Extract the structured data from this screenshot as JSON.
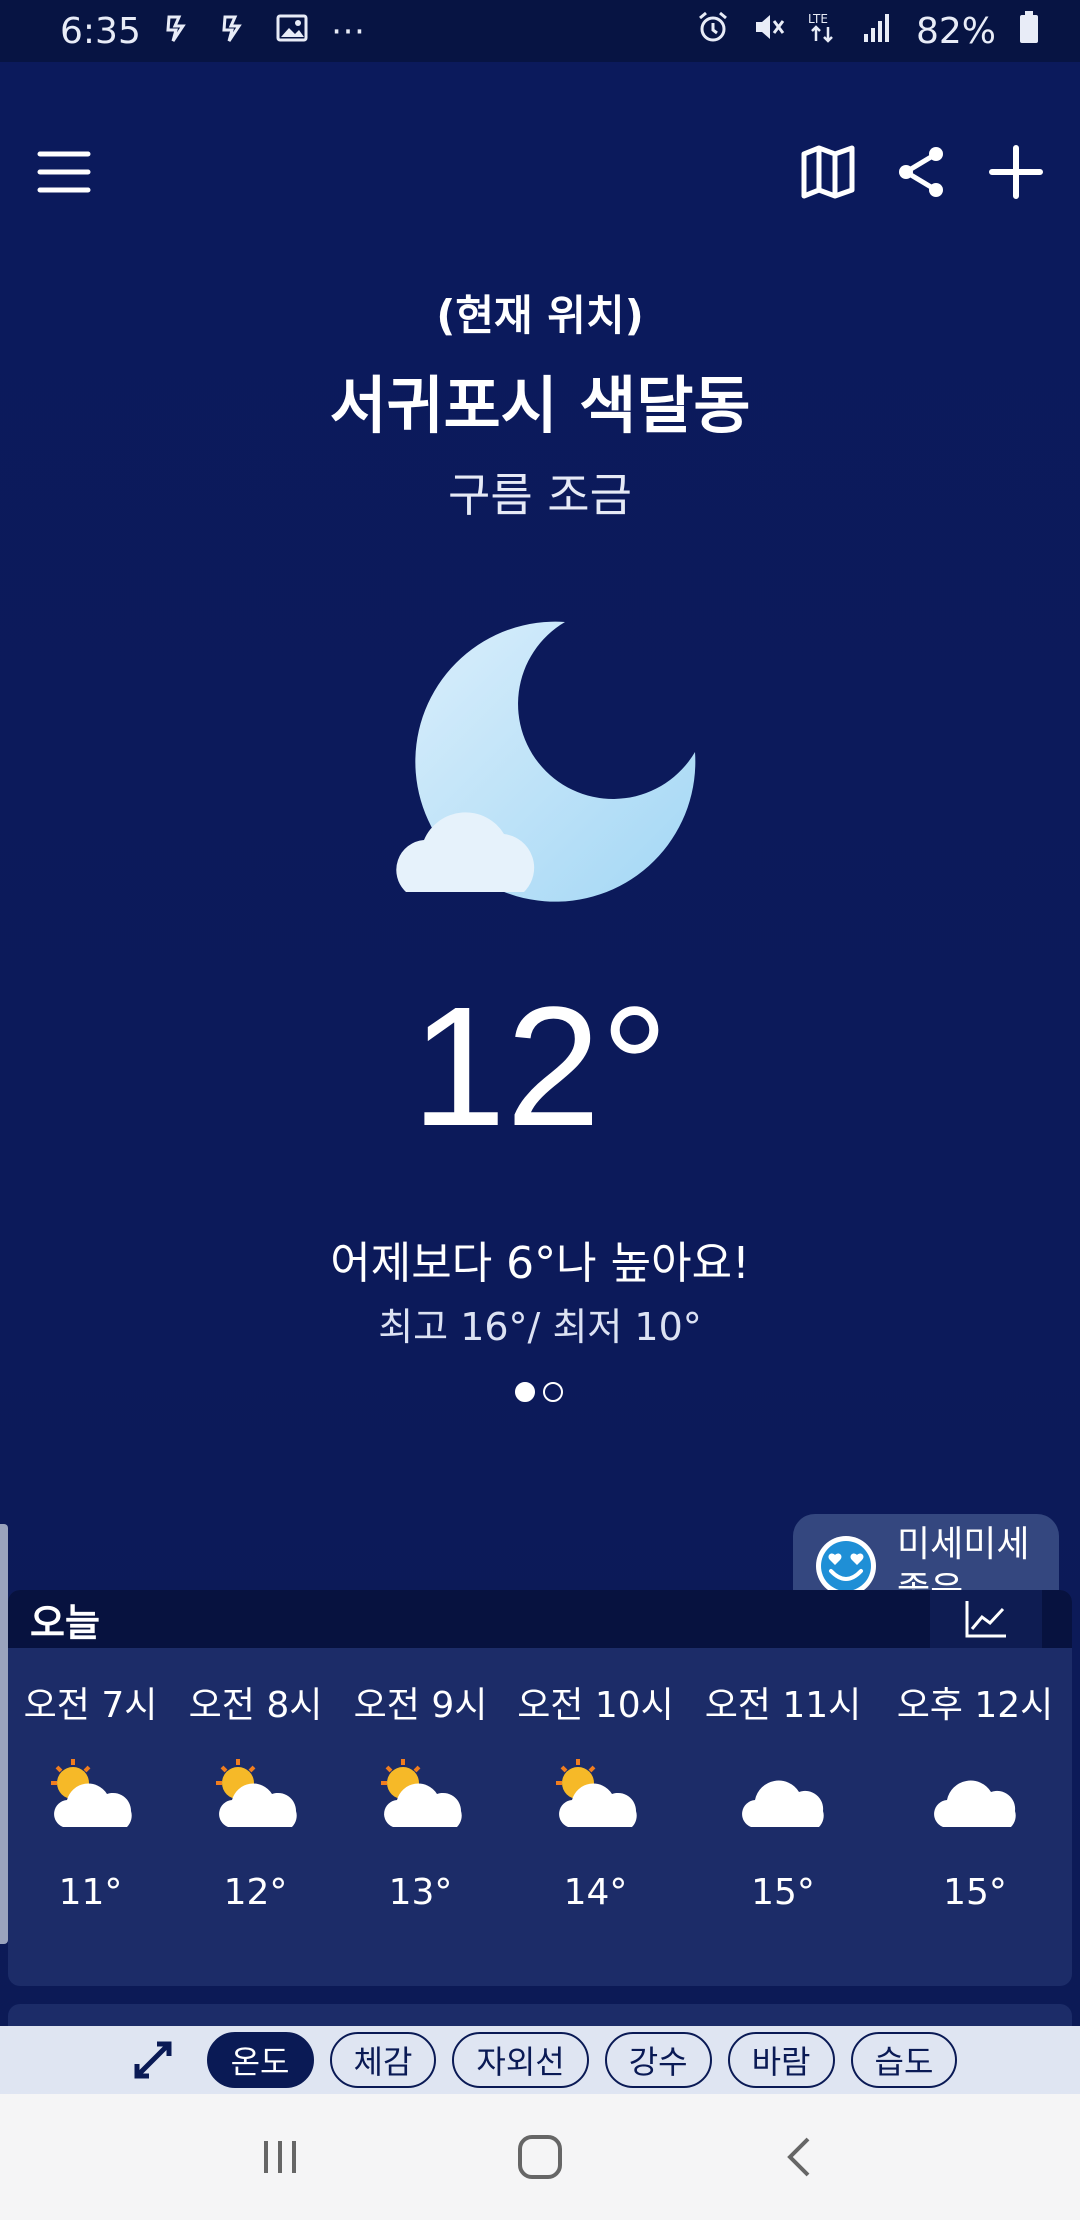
{
  "status_bar": {
    "time": "6:35",
    "left_icons": [
      "flash-icon",
      "flash-icon",
      "image-icon",
      "more-dots-icon"
    ],
    "battery": "82%",
    "right_icons": [
      "alarm-icon",
      "mute-icon",
      "lte-icon",
      "signal-icon",
      "battery-icon"
    ]
  },
  "header": {
    "menu_icon": "hamburger-icon",
    "actions": [
      "map-icon",
      "share-icon",
      "add-icon"
    ]
  },
  "current": {
    "location_caption": "(현재 위치)",
    "location_name": "서귀포시 색달동",
    "condition": "구름 조금",
    "icon": "moon-cloud-icon",
    "temperature": "12°",
    "comparison": "어제보다 6°나 높아요!",
    "high_low": "최고 16°/ 최저 10°",
    "page_count": 2,
    "active_page": 1
  },
  "fine_dust": {
    "icon": "smiley-heart-eyes-icon",
    "label": "미세미세",
    "status": "좋음"
  },
  "today": {
    "title": "오늘",
    "chart_icon": "line-chart-icon",
    "hours": [
      {
        "time": "오전 7시",
        "icon": "sun-cloud-icon",
        "temp": "11°"
      },
      {
        "time": "오전 8시",
        "icon": "sun-cloud-icon",
        "temp": "12°"
      },
      {
        "time": "오전 9시",
        "icon": "sun-cloud-icon",
        "temp": "13°"
      },
      {
        "time": "오전 10시",
        "icon": "sun-cloud-icon",
        "temp": "14°"
      },
      {
        "time": "오전 11시",
        "icon": "cloud-icon",
        "temp": "15°"
      },
      {
        "time": "오후 12시",
        "icon": "cloud-icon",
        "temp": "15°"
      }
    ]
  },
  "filters": {
    "expand_icon": "expand-icon",
    "chips": [
      "온도",
      "체감",
      "자외선",
      "강수",
      "바람",
      "습도"
    ],
    "selected": "온도"
  },
  "nav": [
    "recents-icon",
    "home-icon",
    "back-icon"
  ],
  "colors": {
    "background": "#0b1a5c",
    "status_bar": "#071443",
    "panel": "#1c2c68",
    "dust_card": "#34477f",
    "chip_selected": "#0a1a55",
    "filter_bar": "#dfe5f2"
  }
}
